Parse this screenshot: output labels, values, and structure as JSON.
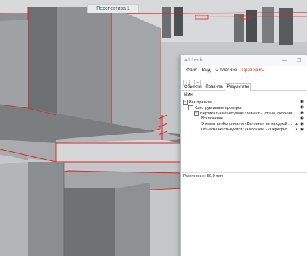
{
  "viewport": {
    "tab_caption": "Перспектива 1"
  },
  "window": {
    "title": "Allcheck",
    "controls": {
      "minimize": "—",
      "maximize": "☐"
    },
    "menu": [
      "Файл",
      "Вид",
      "О плагине"
    ],
    "menu_accent": "Проверить",
    "toolbar": {
      "add": "+",
      "remove": "–"
    },
    "tabs": [
      "Объекты",
      "Правила",
      "Результаты"
    ],
    "column_header": "Имя",
    "tree": {
      "root": "Все правила",
      "group": "Конструктивные проверки",
      "rule": "Вертикальные несущие элементы (стена, колонна...",
      "exclusion": "Исключение",
      "result1": "Элементы «Колонна» и «Колонна» не на одной ...",
      "result2": "Объекты не стыкуются: «Колонна» - «Перекрыт..."
    },
    "status": "Расстояние: 50.0 mm"
  },
  "colors": {
    "accent_red": "#d93a3a",
    "highlight_edge": "#e11f1f"
  }
}
